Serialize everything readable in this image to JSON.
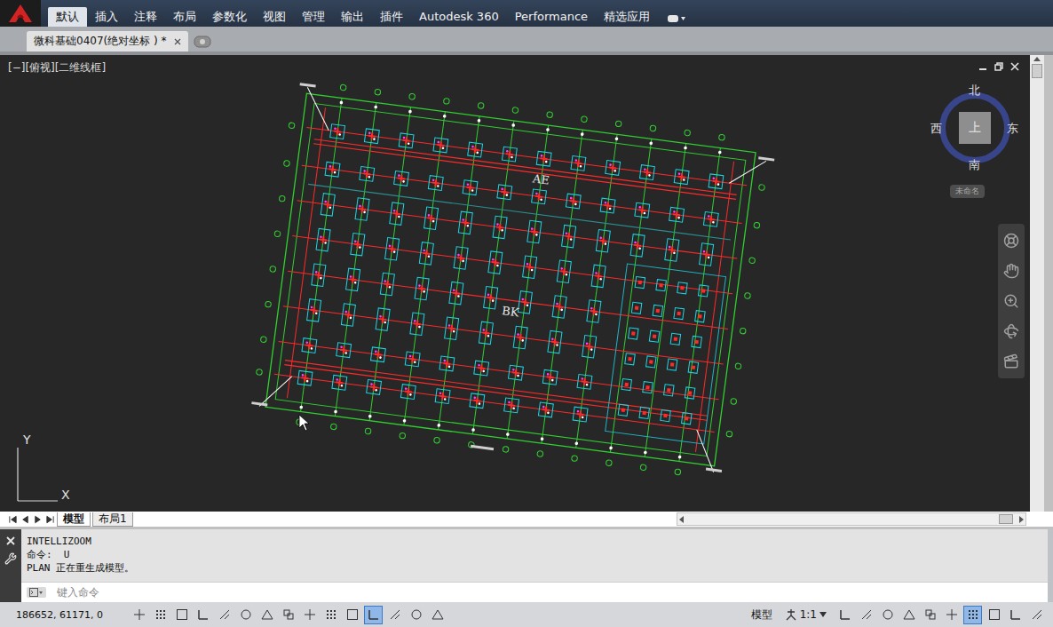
{
  "ribbon": {
    "tabs": [
      {
        "label": "默认",
        "selected": true
      },
      {
        "label": "插入",
        "selected": false
      },
      {
        "label": "注释",
        "selected": false
      },
      {
        "label": "布局",
        "selected": false
      },
      {
        "label": "参数化",
        "selected": false
      },
      {
        "label": "视图",
        "selected": false
      },
      {
        "label": "管理",
        "selected": false
      },
      {
        "label": "输出",
        "selected": false
      },
      {
        "label": "插件",
        "selected": false
      },
      {
        "label": "Autodesk 360",
        "selected": false
      },
      {
        "label": "Performance",
        "selected": false
      },
      {
        "label": "精选应用",
        "selected": false
      }
    ]
  },
  "document_tabs": [
    {
      "label": "微科基础0407(绝对坐标 ) *",
      "selected": true
    }
  ],
  "viewport": {
    "label": "[−][俯视][二维线框]"
  },
  "viewcube": {
    "north": "北",
    "south": "南",
    "east": "东",
    "west": "西",
    "face": "上",
    "ucs": "未命名"
  },
  "ucs_icon": {
    "x": "X",
    "y": "Y"
  },
  "drawing": {
    "labels": [
      "AE",
      "BK"
    ]
  },
  "layout_tabs": [
    {
      "label": "模型",
      "selected": true
    },
    {
      "label": "布局1",
      "selected": false
    }
  ],
  "command": {
    "history": [
      "INTELLIZOOM",
      "命令:  U",
      "PLAN 正在重生成模型。"
    ],
    "placeholder": "键入命令"
  },
  "status_bar": {
    "coordinates": "186652, 61171, 0",
    "left_toggles": [
      {
        "on": false
      },
      {
        "on": false
      },
      {
        "on": false
      },
      {
        "on": false
      },
      {
        "on": false
      },
      {
        "on": false
      },
      {
        "on": false
      },
      {
        "on": false
      },
      {
        "on": false
      },
      {
        "on": false
      },
      {
        "on": false
      },
      {
        "on": true
      },
      {
        "on": false
      },
      {
        "on": false
      },
      {
        "on": false
      }
    ],
    "space": "模型",
    "scale": "1:1",
    "right_toggles": [
      {
        "on": false
      },
      {
        "on": false
      },
      {
        "on": false
      },
      {
        "on": false
      },
      {
        "on": false
      },
      {
        "on": false
      },
      {
        "on": true
      },
      {
        "on": false
      },
      {
        "on": false
      },
      {
        "on": false
      }
    ]
  }
}
